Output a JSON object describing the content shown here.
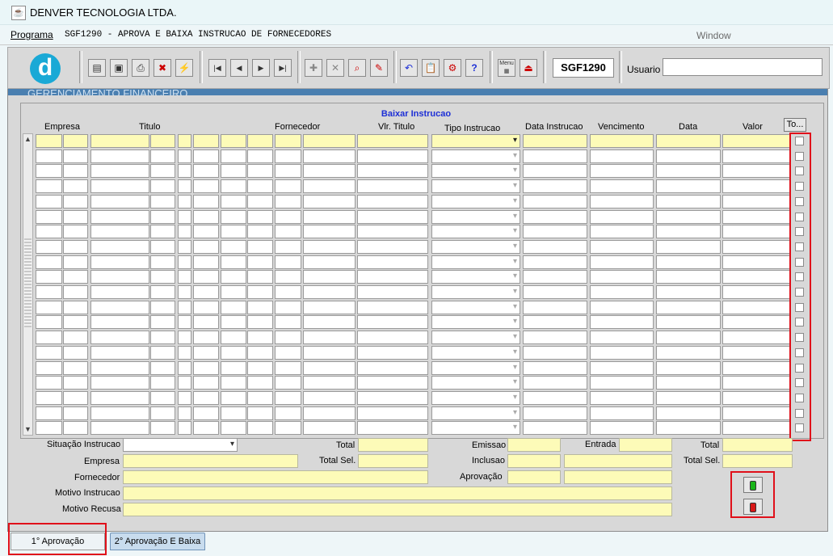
{
  "window": {
    "title": "DENVER TECNOLOGIA LTDA.",
    "icon": "java-coffee-icon"
  },
  "menu": {
    "programa_label": "Programa",
    "program_text": "SGF1290 - APROVA E BAIXA INSTRUCAO DE FORNECEDORES",
    "window_label": "Window"
  },
  "toolbar": {
    "logo_letter": "d",
    "program_code": "SGF1290",
    "user_label": "Usuario",
    "user_value": "",
    "buttons": [
      "save-icon",
      "window-icon",
      "print-icon",
      "clear-icon",
      "execute-icon",
      "first-record-icon",
      "previous-record-icon",
      "next-record-icon",
      "last-record-icon",
      "insert-record-icon",
      "delete-record-icon",
      "query-icon",
      "edit-icon",
      "undo-icon",
      "clipboard-icon",
      "config-icon",
      "help-icon",
      "menu-icon",
      "exit-icon"
    ]
  },
  "panel": {
    "header_text": "GERENCIAMENTO FINANCEIRO"
  },
  "grid": {
    "frame_title": "Baixar Instrucao",
    "columns": {
      "empresa": "Empresa",
      "titulo": "Titulo",
      "fornecedor": "Fornecedor",
      "vlr_titulo": "Vlr. Titulo",
      "tipo_instrucao": "Tipo Instrucao",
      "data_instrucao": "Data Instrucao",
      "vencimento": "Vencimento",
      "data": "Data",
      "valor": "Valor"
    },
    "toggle_all_label": "To...",
    "row_count": 20
  },
  "summary": {
    "situacao_label": "Situação Instrucao",
    "situacao_value": "",
    "empresa_label": "Empresa",
    "fornecedor_label": "Fornecedor",
    "motivo_instrucao_label": "Motivo Instrucao",
    "motivo_recusa_label": "Motivo Recusa",
    "total_label": "Total",
    "total_sel_label": "Total Sel.",
    "emissao_label": "Emissao",
    "inclusao_label": "Inclusao",
    "aprovacao_label": "Aprovação",
    "entrada_label": "Entrada",
    "total2_label": "Total",
    "total_sel2_label": "Total Sel."
  },
  "actions": {
    "approve_icon": "traffic-light-green-icon",
    "reject_icon": "traffic-light-red-icon"
  },
  "tabs": [
    {
      "label": "1° Aprovação",
      "active": true
    },
    {
      "label": "2° Aprovação E Baixa",
      "active": false
    }
  ],
  "colors": {
    "highlight_red": "#e0101a",
    "field_yellow": "#fdfbb8",
    "title_blue": "#1d2fd6",
    "logo_blue": "#1aa9d6"
  }
}
